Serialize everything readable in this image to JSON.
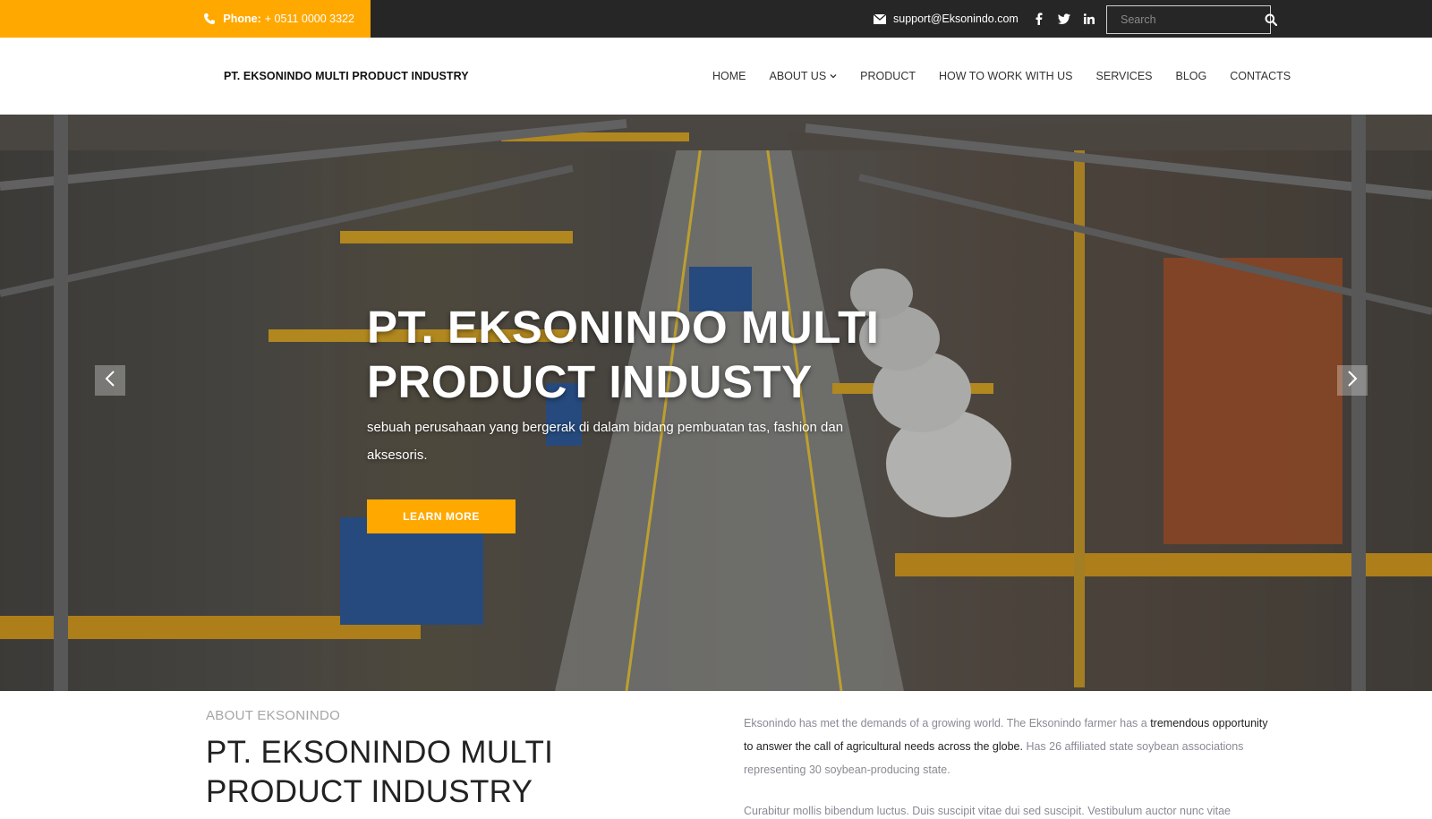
{
  "topbar": {
    "phone_label": "Phone:",
    "phone_number": "+ 0511 0000 3322",
    "email": "support@Eksonindo.com",
    "search_placeholder": "Search"
  },
  "navbar": {
    "brand": "PT. EKSONINDO MULTI PRODUCT INDUSTRY",
    "items": [
      {
        "label": "HOME"
      },
      {
        "label": "ABOUT US"
      },
      {
        "label": "PRODUCT"
      },
      {
        "label": "HOW TO WORK WITH US"
      },
      {
        "label": "SERVICES"
      },
      {
        "label": "BLOG"
      },
      {
        "label": "CONTACTS"
      }
    ]
  },
  "hero": {
    "title_line1": "PT. EKSONINDO MULTI",
    "title_line2": "PRODUCT INDUSTY",
    "subtitle": "sebuah perusahaan yang bergerak di dalam bidang pembuatan tas, fashion dan aksesoris.",
    "button_label": "LEARN MORE"
  },
  "about": {
    "label": "ABOUT EKSONINDO",
    "title_line1": "PT. EKSONINDO MULTI",
    "title_line2": "PRODUCT INDUSTRY",
    "p1_part1": "Eksonindo has met the demands of a growing world. The Eksonindo farmer has a ",
    "p1_highlight": "tremendous opportunity to answer the call of agricultural needs across the globe.",
    "p1_part2": " Has 26 affiliated state soybean associations representing 30 soybean-producing state.",
    "p2": "Curabitur mollis bibendum luctus. Duis suscipit vitae dui sed suscipit. Vestibulum auctor nunc vitae"
  },
  "icons": {
    "phone": "phone-icon",
    "mail": "mail-icon",
    "facebook": "facebook-icon",
    "twitter": "twitter-icon",
    "linkedin": "linkedin-icon",
    "search": "search-icon",
    "chevron_down": "chevron-down-icon",
    "prev": "chevron-left-icon",
    "next": "chevron-right-icon"
  },
  "colors": {
    "accent": "#ffa800",
    "topbar_bg": "#262626",
    "text_dark": "#222222",
    "text_muted": "#8a8a96"
  }
}
